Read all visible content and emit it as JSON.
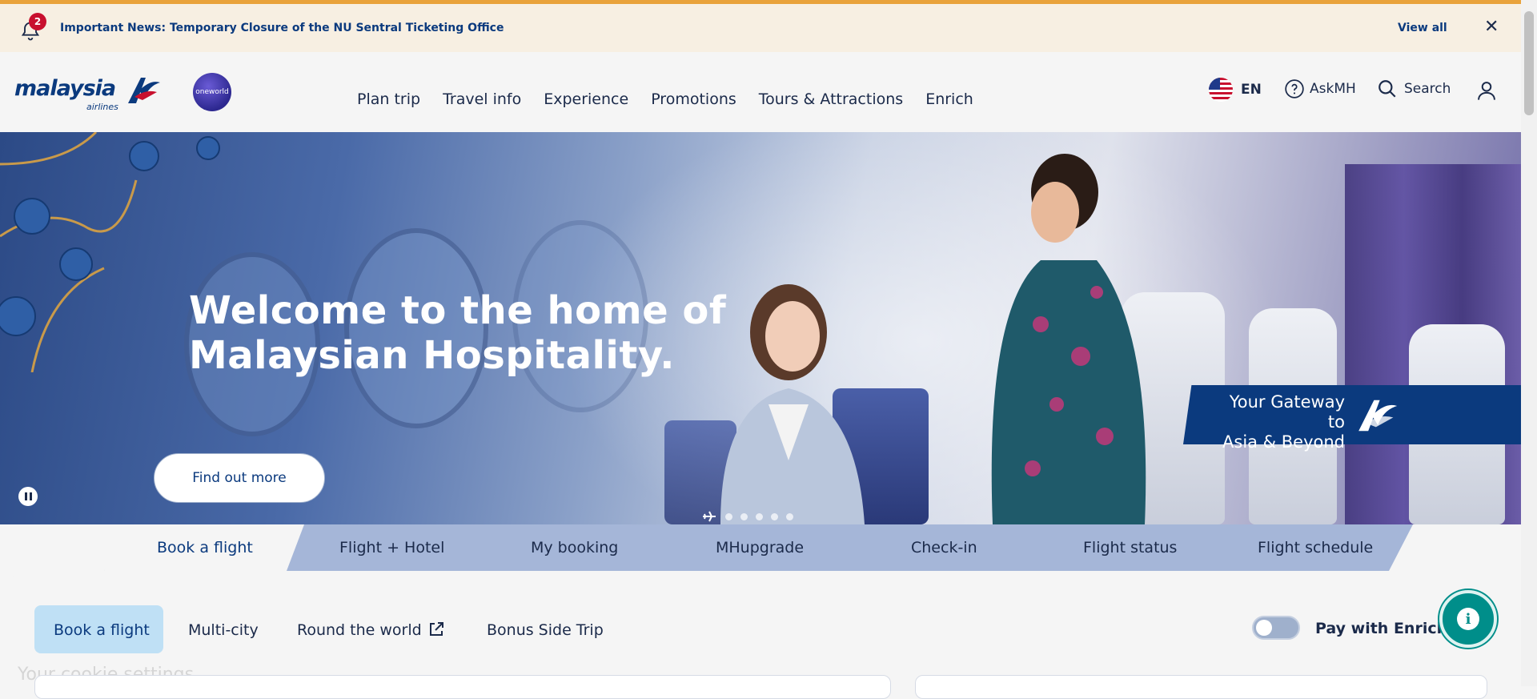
{
  "notification": {
    "count": "2",
    "text": "Important News: Temporary Closure of the NU Sentral Ticketing Office",
    "view_all": "View all",
    "close_icon": "close-icon",
    "accent_color": "#e9a23b"
  },
  "header": {
    "logo_text": "malaysia",
    "logo_sub": "airlines",
    "alliance_logo": "oneworld",
    "nav": [
      {
        "label": "Plan trip"
      },
      {
        "label": "Travel info"
      },
      {
        "label": "Experience"
      },
      {
        "label": "Promotions"
      },
      {
        "label": "Tours & Attractions"
      },
      {
        "label": "Enrich"
      }
    ],
    "language": "EN",
    "ask": "AskMH",
    "search": "Search",
    "icons": [
      "bell-icon",
      "us-flag-icon",
      "help-icon",
      "search-icon",
      "user-icon"
    ]
  },
  "hero": {
    "title_line1": "Welcome to the home of",
    "title_line2": "Malaysian Hospitality.",
    "cta": "Find out more",
    "tagline_line1": "Your Gateway to",
    "tagline_line2": "Asia & Beyond",
    "brand_color": "#0b3a7e"
  },
  "booking_tabs": [
    {
      "label": "Book a flight",
      "active": true
    },
    {
      "label": "Flight + Hotel"
    },
    {
      "label": "My booking"
    },
    {
      "label": "MHupgrade"
    },
    {
      "label": "Check-in"
    },
    {
      "label": "Flight status"
    },
    {
      "label": "Flight schedule"
    }
  ],
  "booking_subtabs": [
    {
      "label": "Book a flight",
      "active": true
    },
    {
      "label": "Multi-city"
    },
    {
      "label": "Round the world"
    },
    {
      "label": "Bonus Side Trip"
    }
  ],
  "pay_with": "Pay with Enrich Points",
  "cookie_text": "Your cookie settings",
  "fab_color": "#008e8a"
}
